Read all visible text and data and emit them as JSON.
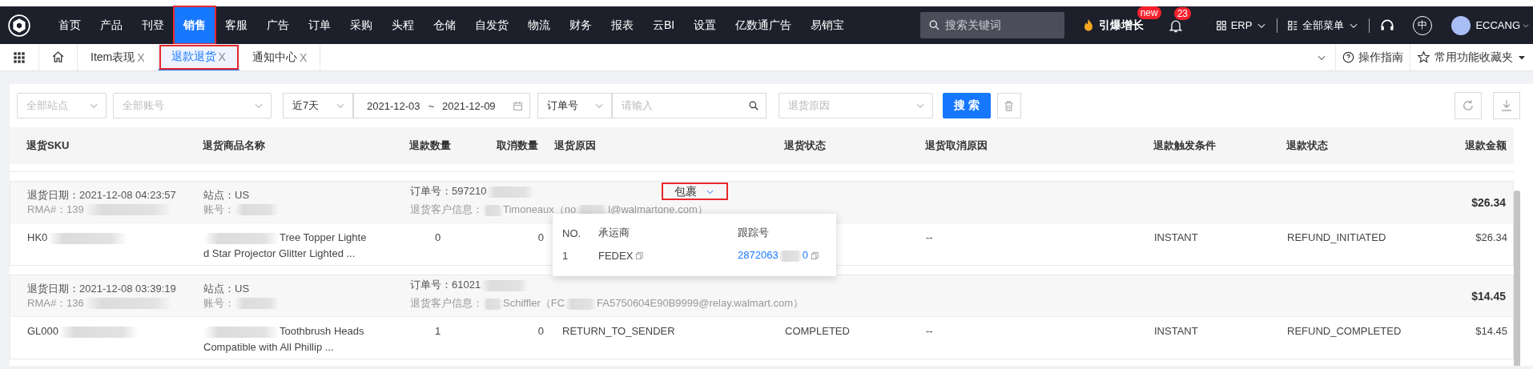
{
  "nav": {
    "items": [
      {
        "label": "首页",
        "selected": false,
        "outlined": false
      },
      {
        "label": "产品",
        "selected": false,
        "outlined": false
      },
      {
        "label": "刊登",
        "selected": false,
        "outlined": false
      },
      {
        "label": "销售",
        "selected": true,
        "outlined": true
      },
      {
        "label": "客服",
        "selected": false,
        "outlined": false
      },
      {
        "label": "广告",
        "selected": false,
        "outlined": false
      },
      {
        "label": "订单",
        "selected": false,
        "outlined": false
      },
      {
        "label": "采购",
        "selected": false,
        "outlined": false
      },
      {
        "label": "头程",
        "selected": false,
        "outlined": false
      },
      {
        "label": "仓储",
        "selected": false,
        "outlined": false
      },
      {
        "label": "自发货",
        "selected": false,
        "outlined": false
      },
      {
        "label": "物流",
        "selected": false,
        "outlined": false
      },
      {
        "label": "财务",
        "selected": false,
        "outlined": false
      },
      {
        "label": "报表",
        "selected": false,
        "outlined": false
      },
      {
        "label": "云BI",
        "selected": false,
        "outlined": false
      },
      {
        "label": "设置",
        "selected": false,
        "outlined": false
      },
      {
        "label": "亿数通广告",
        "selected": false,
        "outlined": false
      },
      {
        "label": "易销宝",
        "selected": false,
        "outlined": false
      }
    ],
    "search": {
      "placeholder": "搜索关键词"
    },
    "promo": {
      "label": "引爆增长",
      "badge": "new"
    },
    "notifications": "23",
    "erp": "ERP",
    "all_menu": "全部菜单",
    "language": "中",
    "user": "ECCANG"
  },
  "tabbar": {
    "tabs": [
      {
        "label": "Item表现",
        "close": "X",
        "selected": false,
        "outlined": false
      },
      {
        "label": "退款退货",
        "close": "X",
        "selected": true,
        "outlined": true
      },
      {
        "label": "通知中心",
        "close": "X",
        "selected": false,
        "outlined": false
      }
    ],
    "guide": "操作指南",
    "favorites": "常用功能收藏夹"
  },
  "filters": {
    "site": "全部站点",
    "account": "全部账号",
    "period": "近7天",
    "date_start": "2021-12-03",
    "date_sep": "~",
    "date_end": "2021-12-09",
    "order_type": "订单号",
    "keyword_placeholder": "请输入",
    "reason_placeholder": "退货原因",
    "search_button": "搜 索"
  },
  "table": {
    "columns": [
      "退货SKU",
      "退货商品名称",
      "退款数量",
      "取消数量",
      "退货原因",
      "退货状态",
      "退货取消原因",
      "退款触发条件",
      "退款状态",
      "退款金额"
    ],
    "groups": [
      {
        "return_date": "退货日期：2021-12-08 04:23:57",
        "rma": [
          {
            "kind": "text",
            "text": "RMA#：139"
          },
          {
            "kind": "blur"
          }
        ],
        "site": "站点：US",
        "account": [
          {
            "kind": "text",
            "text": "账号："
          },
          {
            "kind": "blur"
          }
        ],
        "order": [
          {
            "kind": "text",
            "text": "订单号：597210"
          },
          {
            "kind": "blur"
          }
        ],
        "customer": [
          {
            "kind": "text",
            "text": "退货客户信息："
          },
          {
            "kind": "blur"
          },
          {
            "kind": "text",
            "text": "Timoneaux（no"
          },
          {
            "kind": "blur"
          },
          {
            "kind": "text",
            "text": "l@walmartone.com）"
          }
        ],
        "package": {
          "label": "包裹",
          "expanded": true,
          "outlined": true
        },
        "total": "$26.34",
        "item": {
          "sku": [
            {
              "kind": "text",
              "text": "HK0"
            },
            {
              "kind": "blur"
            }
          ],
          "name": [
            {
              "kind": "blur"
            },
            {
              "kind": "text",
              "text": "Tree Topper Lighted Star Projector Glitter Lighted ..."
            }
          ],
          "refund_qty": "0",
          "cancel_qty": "0",
          "trigger": "INSTANT",
          "refund_status": "REFUND_INITIATED",
          "amount": "$26.34",
          "cancel_reason": "--"
        },
        "shipments": {
          "columns": [
            "NO.",
            "承运商",
            "跟踪号"
          ],
          "rows": [
            {
              "no": "1",
              "carrier": "FEDEX",
              "tracking": [
                {
                  "kind": "text",
                  "text": "2872063"
                },
                {
                  "kind": "blur"
                },
                {
                  "kind": "text",
                  "text": "0"
                }
              ]
            }
          ]
        }
      },
      {
        "return_date": "退货日期：2021-12-08 03:39:19",
        "rma": [
          {
            "kind": "text",
            "text": "RMA#：136"
          },
          {
            "kind": "blur"
          }
        ],
        "site": "站点：US",
        "account": [
          {
            "kind": "text",
            "text": "账号："
          },
          {
            "kind": "blur"
          }
        ],
        "order": [
          {
            "kind": "text",
            "text": "订单号：61021"
          },
          {
            "kind": "blur"
          }
        ],
        "customer": [
          {
            "kind": "text",
            "text": "退货客户信息："
          },
          {
            "kind": "blur"
          },
          {
            "kind": "text",
            "text": "Schiffler（FC"
          },
          {
            "kind": "blur"
          },
          {
            "kind": "text",
            "text": "FA5750604E90B9999@relay.walmart.com）"
          }
        ],
        "total": "$14.45",
        "item": {
          "sku": [
            {
              "kind": "text",
              "text": "GL000"
            },
            {
              "kind": "blur"
            }
          ],
          "name": [
            {
              "kind": "blur"
            },
            {
              "kind": "text",
              "text": "Toothbrush Heads Compatible with All Phillip ..."
            }
          ],
          "refund_qty": "1",
          "cancel_qty": "0",
          "reason": "RETURN_TO_SENDER",
          "status": "COMPLETED",
          "cancel_reason": "--",
          "trigger": "INSTANT",
          "refund_status": "REFUND_COMPLETED",
          "amount": "$14.45"
        }
      }
    ]
  }
}
